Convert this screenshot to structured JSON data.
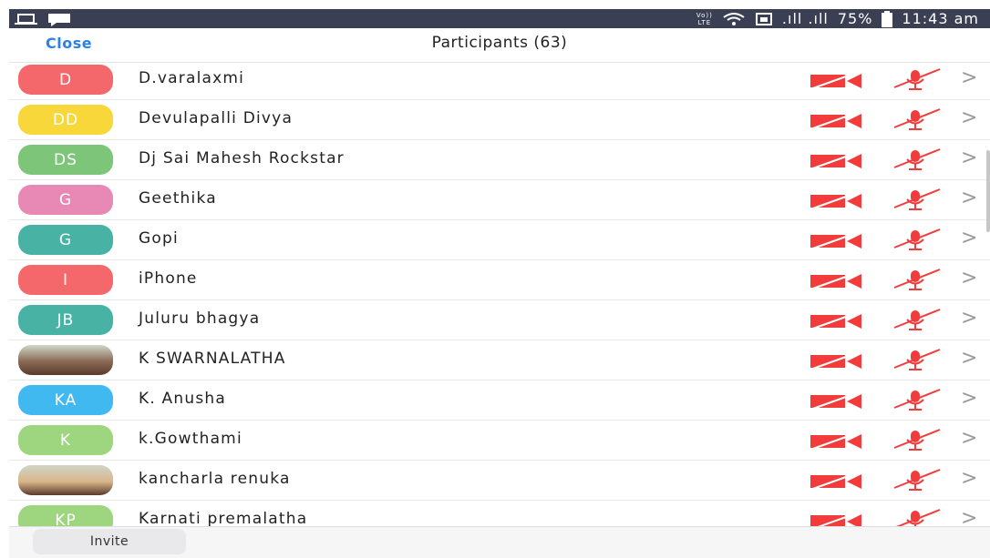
{
  "status_bar": {
    "volte_top": "Vo))",
    "volte_bottom": "LTE",
    "signal": ".ıll .ıll",
    "battery": "75%",
    "time": "11:43 am",
    "icons": [
      "laptop-icon",
      "chat-icon",
      "wifi-icon",
      "signal-icon",
      "battery-icon"
    ]
  },
  "header": {
    "close_label": "Close",
    "title": "Participants (63)"
  },
  "participants": [
    {
      "initials": "D",
      "name": "D.varalaxmi",
      "color": "#f4686b"
    },
    {
      "initials": "DD",
      "name": "Devulapalli Divya",
      "color": "#f8d73a"
    },
    {
      "initials": "DS",
      "name": "Dj Sai Mahesh Rockstar",
      "color": "#7dc679"
    },
    {
      "initials": "G",
      "name": "Geethika",
      "color": "#e889b5"
    },
    {
      "initials": "G",
      "name": "Gopi",
      "color": "#48b3a5"
    },
    {
      "initials": "I",
      "name": "iPhone",
      "color": "#f4686b"
    },
    {
      "initials": "JB",
      "name": "Juluru bhagya",
      "color": "#48b3a5"
    },
    {
      "initials": "",
      "name": "K SWARNALATHA",
      "color": "#8a6a55"
    },
    {
      "initials": "KA",
      "name": "K. Anusha",
      "color": "#3fb9f0"
    },
    {
      "initials": "K",
      "name": "k.Gowthami",
      "color": "#9ed57f"
    },
    {
      "initials": "",
      "name": "kancharla renuka",
      "color": "#d9b58a"
    },
    {
      "initials": "KP",
      "name": "Karnati premalatha",
      "color": "#9ed57f"
    }
  ],
  "row_icons": {
    "camera": "video-off-icon",
    "mic": "mic-muted-icon",
    "chevron": ">"
  },
  "colors": {
    "accent": "#2a82e4",
    "muted_red": "#f23b3b",
    "status_bar": "#3b3f53"
  },
  "footer": {
    "invite_label": "Invite"
  }
}
